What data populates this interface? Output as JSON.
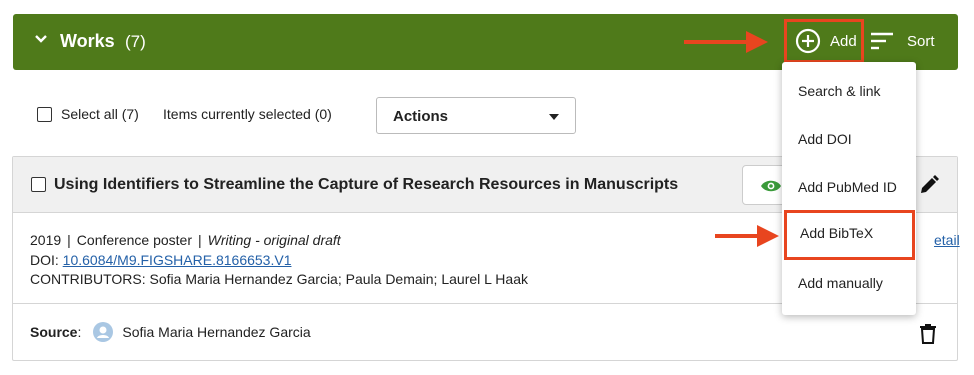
{
  "header": {
    "title": "Works",
    "count": "(7)",
    "add_label": "Add",
    "sort_label": "Sort",
    "color": "#4f7a1a"
  },
  "toolbar": {
    "select_all_label": "Select all (7)",
    "items_selected_label": "Items currently selected (0)",
    "actions_label": "Actions"
  },
  "work": {
    "title": "Using Identifiers to Streamline the Capture of Research Resources in Manuscripts",
    "year": "2019",
    "type": "Conference poster",
    "role": "Writing - original draft",
    "doi_label": "DOI:",
    "doi": "10.6084/M9.FIGSHARE.8166653.V1",
    "contributors_label": "CONTRIBUTORS:",
    "contributors": "Sofia Maria Hernandez Garcia; Paula Demain; Laurel L Haak",
    "detail_link": "etail",
    "source_label": "Source",
    "source_name": "Sofia Maria Hernandez Garcia"
  },
  "add_menu": {
    "items": [
      "Search & link",
      "Add DOI",
      "Add PubMed ID",
      "Add BibTeX",
      "Add manually"
    ],
    "highlighted": "Add BibTeX"
  },
  "annotation_color": "#e8451f",
  "icons": [
    "chevron-down-icon",
    "plus-circle-icon",
    "sort-icon",
    "eye-icon",
    "pencil-icon",
    "user-avatar-icon",
    "trash-icon",
    "arrow-right-icon"
  ]
}
